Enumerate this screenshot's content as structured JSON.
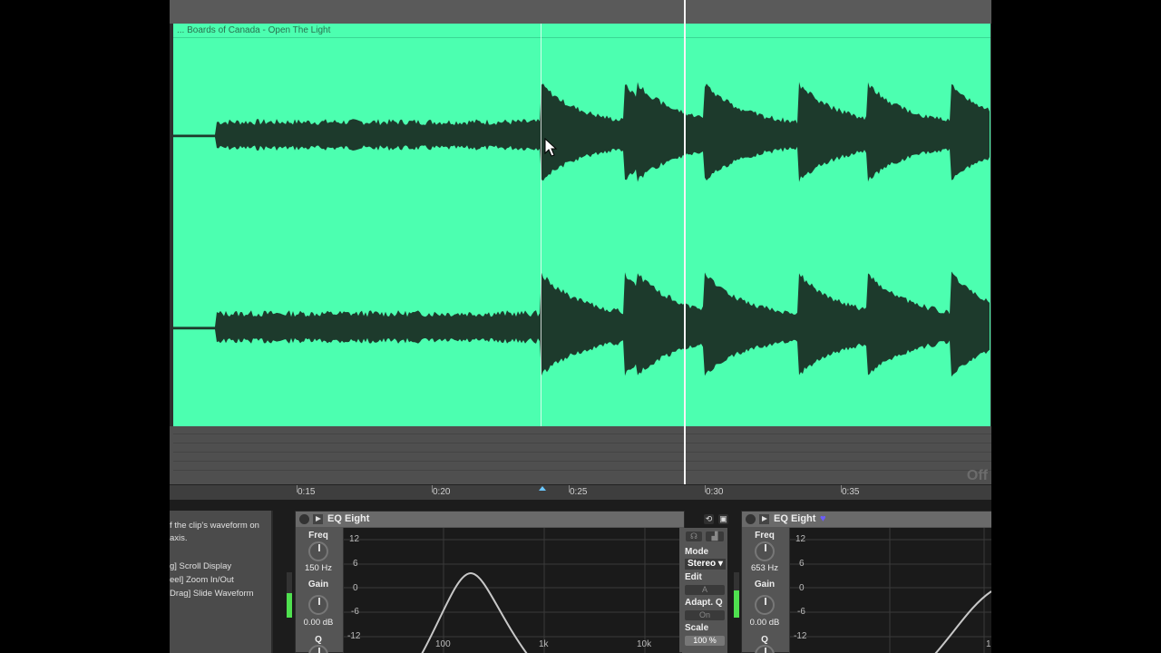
{
  "clip": {
    "title": "... Boards of Canada - Open The Light",
    "color": "#4cffb0",
    "waveform_color": "#1d3a2c"
  },
  "arrangement": {
    "off_label": "Off",
    "ruler_ticks": [
      "0:15",
      "0:20",
      "0:25",
      "0:30",
      "0:35"
    ]
  },
  "info_panel": {
    "lines": [
      "f the clip's waveform on",
      "axis.",
      "g] Scroll Display",
      "eel] Zoom In/Out",
      "Drag] Slide Waveform"
    ]
  },
  "device1": {
    "name": "EQ Eight",
    "freq_label": "Freq",
    "freq_value": "150 Hz",
    "gain_label": "Gain",
    "gain_value": "0.00 dB",
    "q_label": "Q",
    "db_ticks": [
      "12",
      "6",
      "0",
      "-6",
      "-12"
    ],
    "freq_ticks": [
      "100",
      "1k",
      "10k"
    ],
    "mode_label": "Mode",
    "mode_value": "Stereo ▾",
    "edit_label": "Edit",
    "edit_value": "A",
    "adapt_label": "Adapt. Q",
    "adapt_value": "On",
    "scale_label": "Scale",
    "scale_value": "100 %",
    "meter_level": 0.55
  },
  "device2": {
    "name": "EQ Eight",
    "freq_label": "Freq",
    "freq_value": "653 Hz",
    "gain_label": "Gain",
    "gain_value": "0.00 dB",
    "q_label": "Q",
    "db_ticks": [
      "12",
      "6",
      "0",
      "-6",
      "-12"
    ],
    "freq_ticks": [
      "1"
    ],
    "meter_level": 0.6
  }
}
